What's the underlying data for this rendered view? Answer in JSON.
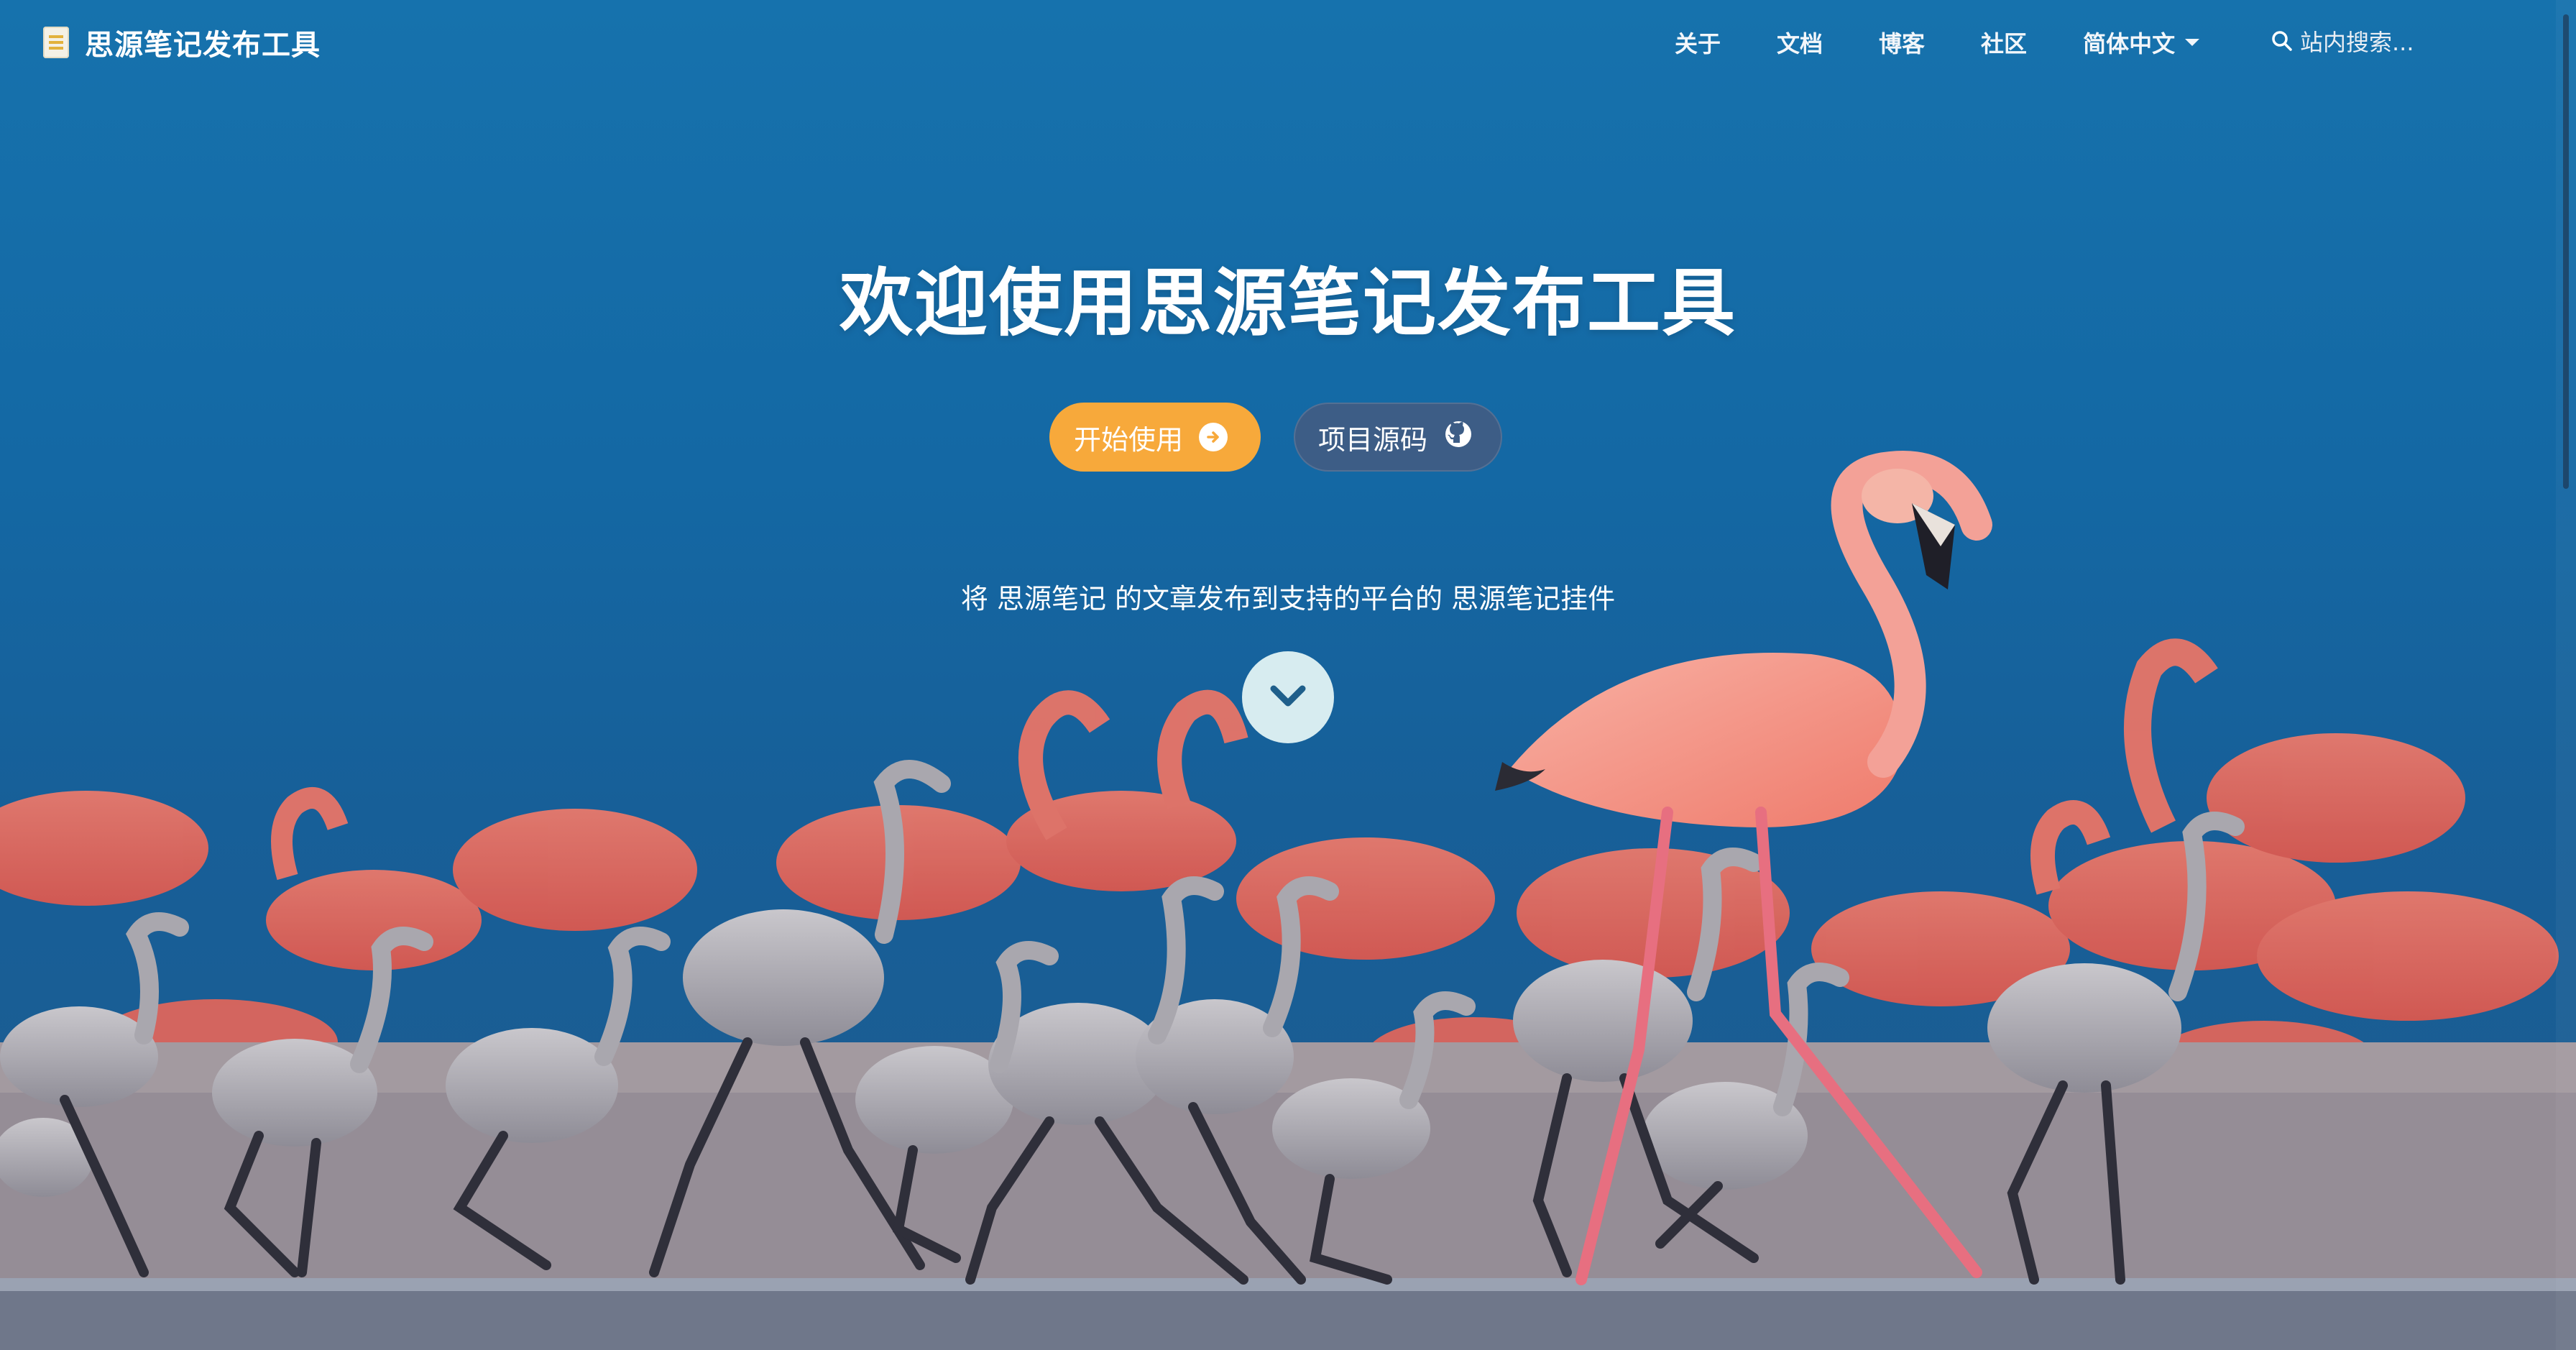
{
  "navbar": {
    "brand_title": "思源笔记发布工具",
    "links": [
      "关于",
      "文档",
      "博客",
      "社区"
    ],
    "language": "简体中文",
    "search_placeholder": "站内搜索..."
  },
  "hero": {
    "title": "欢迎使用思源笔记发布工具",
    "primary_button": "开始使用",
    "secondary_button": "项目源码",
    "description": "将 思源笔记 的文章发布到支持的平台的 思源笔记挂件"
  },
  "colors": {
    "primary_button": "#f7a93b",
    "secondary_button": "#3d5d86",
    "sky": "#1468a4",
    "scroll_down_bg": "#d7ecf0",
    "chevron": "#1f5f8b"
  },
  "icons": {
    "brand": "document-icon",
    "language": "caret-down-icon",
    "search": "search-icon",
    "primary_button": "arrow-right-circle-icon",
    "secondary_button": "github-icon",
    "scroll": "chevron-down-icon"
  }
}
